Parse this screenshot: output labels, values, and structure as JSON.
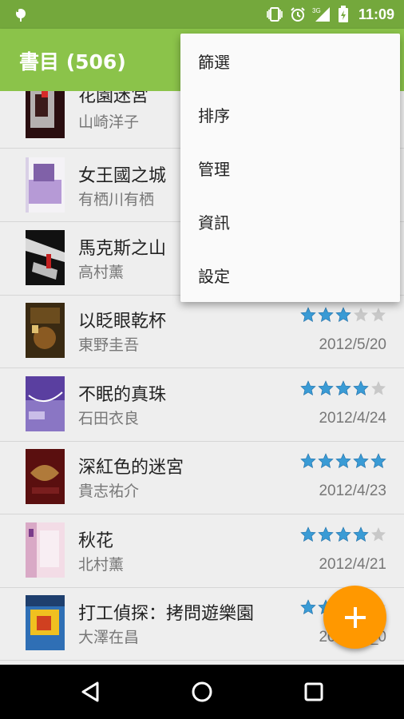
{
  "status_bar": {
    "time": "11:09",
    "network": "3G"
  },
  "app_bar": {
    "title": "書目 (506)"
  },
  "menu": {
    "items": [
      {
        "label": "篩選"
      },
      {
        "label": "排序"
      },
      {
        "label": "管理"
      },
      {
        "label": "資訊"
      },
      {
        "label": "設定"
      }
    ]
  },
  "books": [
    {
      "title": "花園迷宮",
      "author": "山崎洋子",
      "rating": null,
      "date": ""
    },
    {
      "title": "女王國之城",
      "author": "有栖川有栖",
      "rating": null,
      "date": ""
    },
    {
      "title": "馬克斯之山",
      "author": "高村薰",
      "rating": null,
      "date": ""
    },
    {
      "title": "以眨眼乾杯",
      "author": "東野圭吾",
      "rating": 3,
      "date": "2012/5/20"
    },
    {
      "title": "不眠的真珠",
      "author": "石田衣良",
      "rating": 4,
      "date": "2012/4/24"
    },
    {
      "title": "深紅色的迷宮",
      "author": "貴志祐介",
      "rating": 5,
      "date": "2012/4/23"
    },
    {
      "title": "秋花",
      "author": "北村薰",
      "rating": 4,
      "date": "2012/4/21"
    },
    {
      "title": "打工偵探：拷問遊樂園",
      "author": "大澤在昌",
      "rating": 2,
      "date": "201_/_/_0"
    }
  ],
  "fab": {
    "icon": "plus-icon"
  },
  "colors": {
    "status_bar": "#74a83c",
    "app_bar": "#8bc34a",
    "fab": "#ff9800",
    "star_filled": "#3a9bd5",
    "star_empty": "#c8c8c8"
  }
}
